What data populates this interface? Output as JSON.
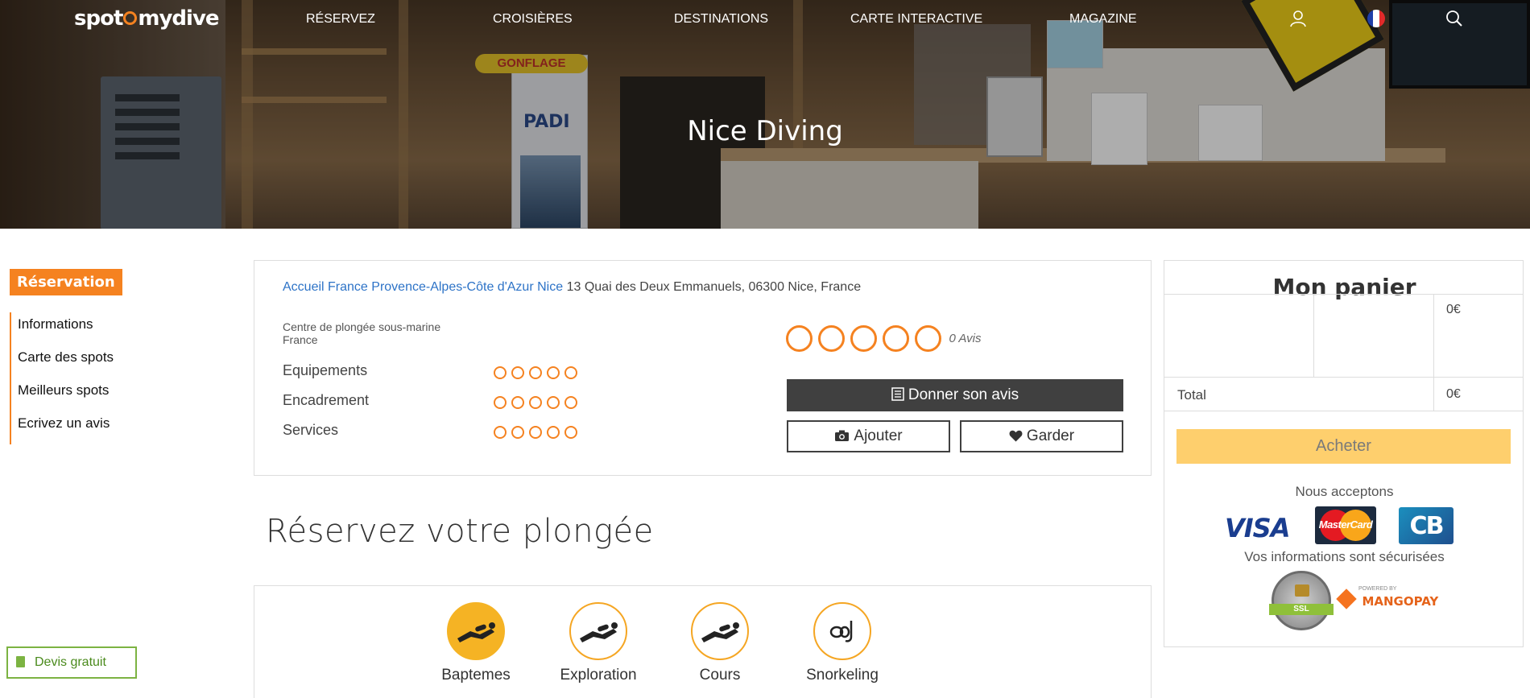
{
  "brand": {
    "name": "spotmydive",
    "accent": "#f58220"
  },
  "nav": {
    "items": [
      "RÉSERVEZ",
      "CROISIÈRES",
      "DESTINATIONS",
      "CARTE INTERACTIVE",
      "MAGAZINE"
    ],
    "icons": [
      "user-icon",
      "flag-fr-icon",
      "search-icon"
    ]
  },
  "hero": {
    "title": "Nice Diving",
    "sign": "GONFLAGE",
    "poster_logo": "PADI"
  },
  "sidebar": {
    "badge": "Réservation",
    "items": [
      "Informations",
      "Carte des spots",
      "Meilleurs spots",
      "Ecrivez un avis"
    ]
  },
  "center": {
    "breadcrumbs": [
      "Accueil",
      "France",
      "Provence-Alpes-Côte d'Azur",
      "Nice"
    ],
    "address": "13 Quai des Deux Emmanuels, 06300 Nice, France",
    "type_line1": "Centre de plongée sous-marine",
    "type_line2": "France",
    "ratings": [
      {
        "label": "Equipements",
        "score": 0,
        "max": 5
      },
      {
        "label": "Encadrement",
        "score": 0,
        "max": 5
      },
      {
        "label": "Services",
        "score": 0,
        "max": 5
      }
    ],
    "overall": {
      "score": 0,
      "max": 5,
      "count_label": "0 Avis"
    },
    "review_button": "Donner son avis",
    "add_button": "Ajouter",
    "keep_button": "Garder"
  },
  "booking": {
    "title": "Réservez votre plongée",
    "activities": [
      {
        "label": "Baptemes",
        "icon": "diver-icon",
        "active": true
      },
      {
        "label": "Exploration",
        "icon": "diver-icon",
        "active": false
      },
      {
        "label": "Cours",
        "icon": "diver-icon",
        "active": false
      },
      {
        "label": "Snorkeling",
        "icon": "snorkel-mask-icon",
        "active": false
      }
    ],
    "active_color": "#f5b324"
  },
  "cart": {
    "title": "Mon panier",
    "line_price": "0€",
    "total_label": "Total",
    "total_value": "0€",
    "buy_button": "Acheter",
    "buy_color": "#fecf6d",
    "accept_text": "Nous acceptons",
    "payment_logos": [
      "VISA",
      "MasterCard",
      "CB"
    ],
    "secure_text": "Vos informations sont sécurisées",
    "ssl_badge": "SSL",
    "processor_powered": "POWERED BY",
    "processor": "MANGOPAY"
  },
  "floating": {
    "quote_button": "Devis gratuit",
    "color": "#7cb342"
  }
}
